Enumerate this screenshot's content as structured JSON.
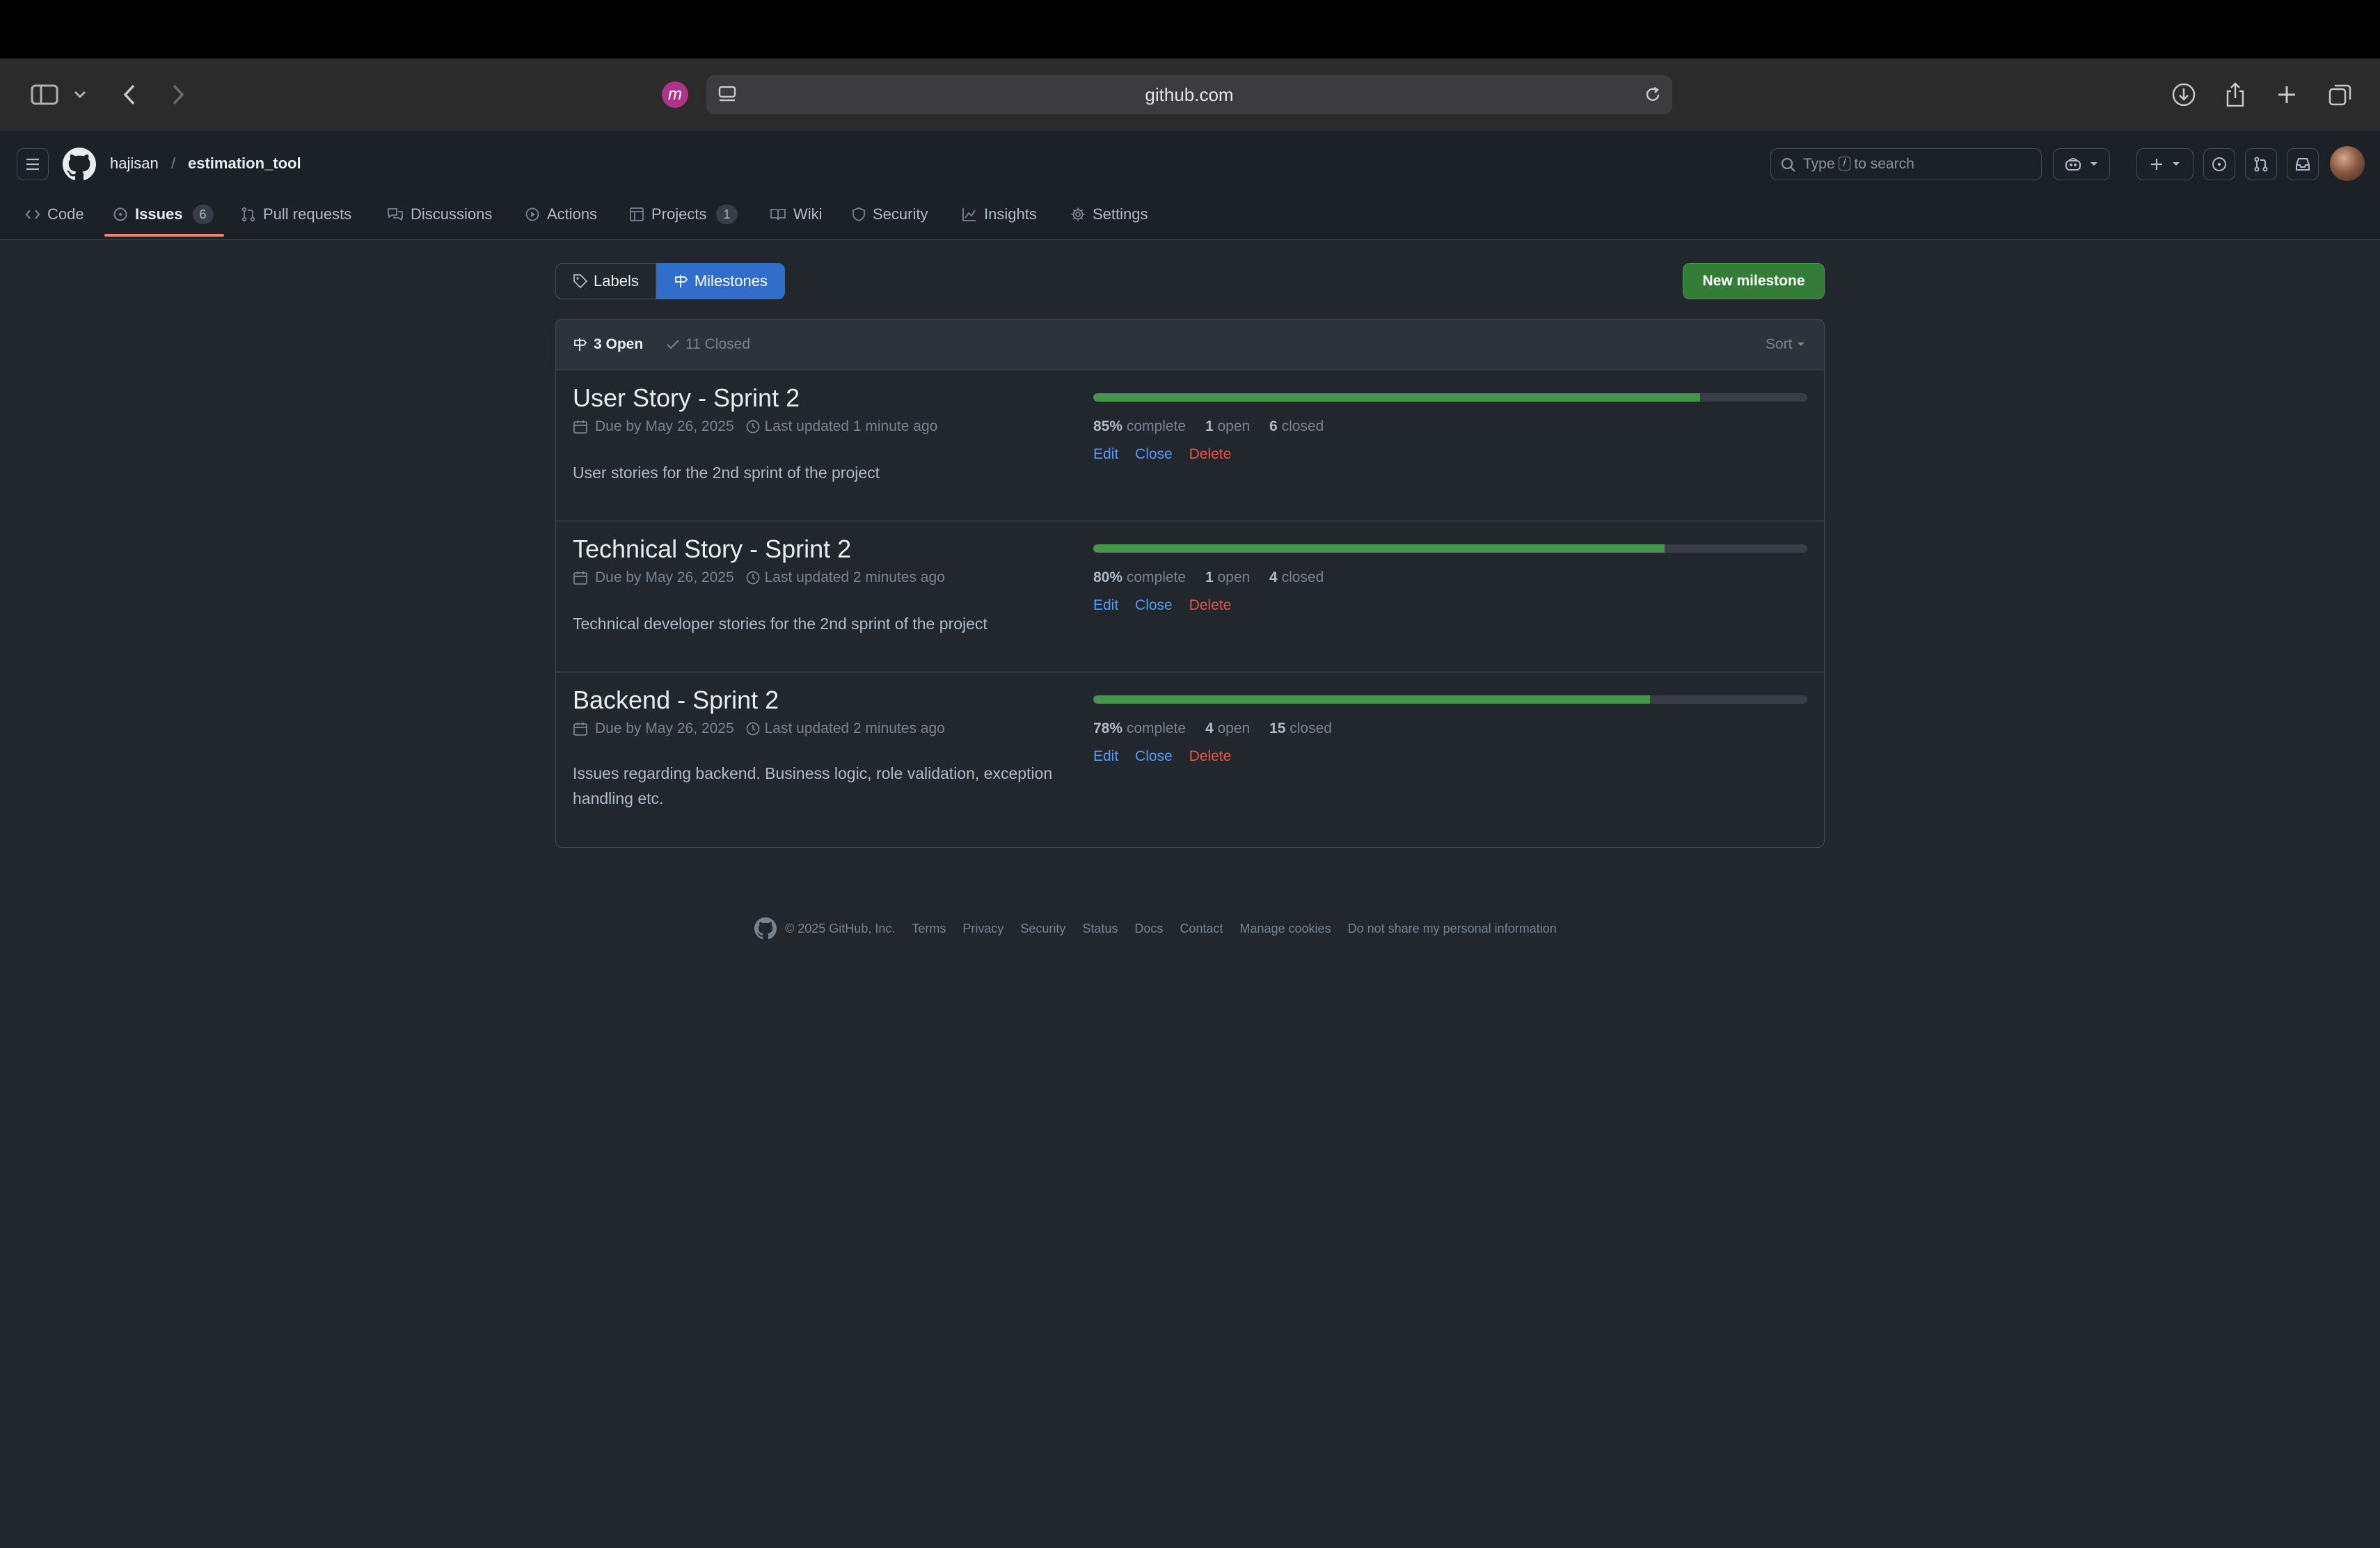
{
  "browser": {
    "url": "github.com",
    "profile_initial": "m"
  },
  "header": {
    "owner": "hajisan",
    "separator": "/",
    "repo": "estimation_tool",
    "search_prefix": "Type",
    "search_key": "/",
    "search_suffix": "to search"
  },
  "repo_nav": [
    {
      "label": "Code",
      "icon": "code-icon"
    },
    {
      "label": "Issues",
      "icon": "issue-opened-icon",
      "count": "6",
      "active": true
    },
    {
      "label": "Pull requests",
      "icon": "git-pull-request-icon"
    },
    {
      "label": "Discussions",
      "icon": "comment-discussion-icon"
    },
    {
      "label": "Actions",
      "icon": "play-icon"
    },
    {
      "label": "Projects",
      "icon": "table-icon",
      "count": "1"
    },
    {
      "label": "Wiki",
      "icon": "book-icon"
    },
    {
      "label": "Security",
      "icon": "shield-icon"
    },
    {
      "label": "Insights",
      "icon": "graph-icon"
    },
    {
      "label": "Settings",
      "icon": "gear-icon"
    }
  ],
  "subnav": {
    "labels": "Labels",
    "milestones": "Milestones",
    "new_milestone": "New milestone"
  },
  "milestones_header": {
    "open": "3 Open",
    "closed": "11 Closed",
    "sort": "Sort"
  },
  "milestones": [
    {
      "title": "User Story - Sprint 2",
      "due": "Due by May 26, 2025",
      "updated": "Last updated 1 minute ago",
      "description": "User stories for the 2nd sprint of the project",
      "progress": 85,
      "percent": "85%",
      "complete_label": "complete",
      "open_count": "1",
      "open_label": "open",
      "closed_count": "6",
      "closed_label": "closed",
      "edit": "Edit",
      "close": "Close",
      "delete": "Delete"
    },
    {
      "title": "Technical Story - Sprint 2",
      "due": "Due by May 26, 2025",
      "updated": "Last updated 2 minutes ago",
      "description": "Technical developer stories for the 2nd sprint of the project",
      "progress": 80,
      "percent": "80%",
      "complete_label": "complete",
      "open_count": "1",
      "open_label": "open",
      "closed_count": "4",
      "closed_label": "closed",
      "edit": "Edit",
      "close": "Close",
      "delete": "Delete"
    },
    {
      "title": "Backend - Sprint 2",
      "due": "Due by May 26, 2025",
      "updated": "Last updated 2 minutes ago",
      "description": "Issues regarding backend. Business logic, role validation, exception handling etc.",
      "progress": 78,
      "percent": "78%",
      "complete_label": "complete",
      "open_count": "4",
      "open_label": "open",
      "closed_count": "15",
      "closed_label": "closed",
      "edit": "Edit",
      "close": "Close",
      "delete": "Delete"
    }
  ],
  "footer": {
    "copyright": "© 2025 GitHub, Inc.",
    "links": [
      "Terms",
      "Privacy",
      "Security",
      "Status",
      "Docs",
      "Contact",
      "Manage cookies",
      "Do not share my personal information"
    ]
  },
  "colors": {
    "background": "#22272e",
    "accent_blue": "#316dca",
    "success_green": "#347d39",
    "danger_red": "#e5534b",
    "tab_underline": "#f78166"
  }
}
